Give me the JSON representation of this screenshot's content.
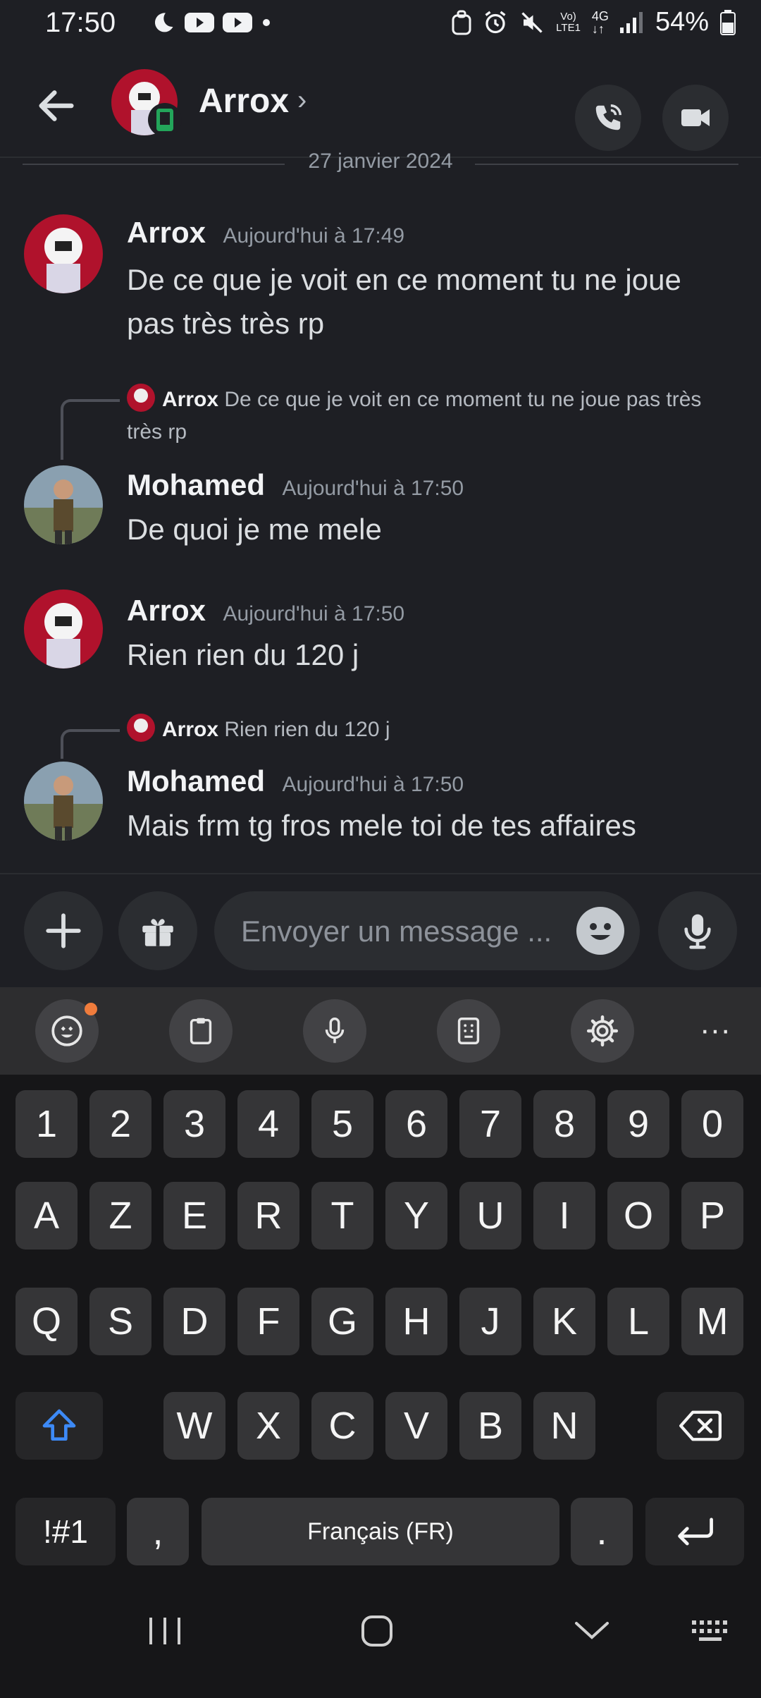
{
  "status_bar": {
    "time": "17:50",
    "battery": "54%",
    "network_top": "Vo)",
    "network_bottom": "LTE1",
    "network_gen": "4G"
  },
  "header": {
    "contact_name": "Arrox",
    "back_icon": "arrow-left-icon",
    "call_icon": "phone-call-icon",
    "video_icon": "video-camera-icon"
  },
  "date_divider": "27 janvier 2024",
  "messages": [
    {
      "author": "Arrox",
      "timestamp": "Aujourd'hui à 17:49",
      "text": "De ce que je voit en ce moment tu ne joue pas très très rp"
    },
    {
      "reply_to_author": "Arrox",
      "reply_to_text": "De ce que je voit en ce moment tu ne joue pas très très rp",
      "author": "Mohamed",
      "timestamp": "Aujourd'hui à 17:50",
      "text": "De quoi je me mele"
    },
    {
      "author": "Arrox",
      "timestamp": "Aujourd'hui à 17:50",
      "text": "Rien rien du 120 j"
    },
    {
      "reply_to_author": "Arrox",
      "reply_to_text": "Rien rien du 120 j",
      "author": "Mohamed",
      "timestamp": "Aujourd'hui à 17:50",
      "text": "Mais frm tg fros mele toi de tes affaires"
    }
  ],
  "composer": {
    "placeholder": "Envoyer un message ..."
  },
  "keyboard": {
    "row_numbers": [
      "1",
      "2",
      "3",
      "4",
      "5",
      "6",
      "7",
      "8",
      "9",
      "0"
    ],
    "row1": [
      "A",
      "Z",
      "E",
      "R",
      "T",
      "Y",
      "U",
      "I",
      "O",
      "P"
    ],
    "row2": [
      "Q",
      "S",
      "D",
      "F",
      "G",
      "H",
      "J",
      "K",
      "L",
      "M"
    ],
    "row3": [
      "W",
      "X",
      "C",
      "V",
      "B",
      "N"
    ],
    "symbols_key": "!#1",
    "comma_key": ",",
    "space_label": "Français (FR)",
    "period_key": ".",
    "toolbar_more": "···"
  }
}
